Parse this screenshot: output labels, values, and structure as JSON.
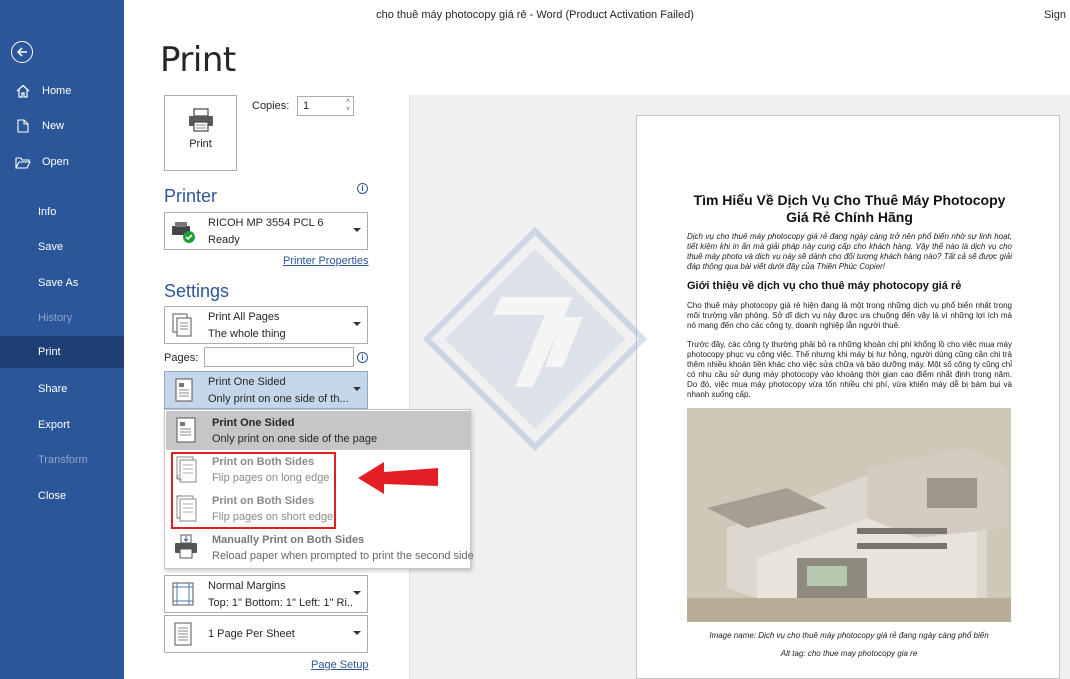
{
  "window": {
    "title": "cho thuê máy photocopy giá rẻ  -  Word (Product Activation Failed)",
    "sign_in": "Sign"
  },
  "sidebar": {
    "items": [
      {
        "label": "Home",
        "icon": "home-icon"
      },
      {
        "label": "New",
        "icon": "new-document-icon"
      },
      {
        "label": "Open",
        "icon": "folder-open-icon"
      },
      {
        "label": "Info"
      },
      {
        "label": "Save"
      },
      {
        "label": "Save As"
      },
      {
        "label": "History"
      },
      {
        "label": "Print"
      },
      {
        "label": "Share"
      },
      {
        "label": "Export"
      },
      {
        "label": "Transform"
      },
      {
        "label": "Close"
      }
    ]
  },
  "print": {
    "heading": "Print",
    "button_label": "Print",
    "copies_label": "Copies:",
    "copies_value": "1"
  },
  "printer": {
    "heading": "Printer",
    "name": "RICOH MP 3554 PCL 6",
    "status": "Ready",
    "properties_link": "Printer Properties"
  },
  "settings": {
    "heading": "Settings",
    "pages_range": {
      "line1": "Print All Pages",
      "line2": "The whole thing"
    },
    "pages_label": "Pages:",
    "pages_value": "",
    "sides": {
      "line1": "Print One Sided",
      "line2": "Only print on one side of th..."
    },
    "margins": {
      "line1": "Normal Margins",
      "line2": "Top: 1\" Bottom: 1\" Left: 1\" Ri..."
    },
    "per_sheet": {
      "line1": "1 Page Per Sheet"
    },
    "page_setup_link": "Page Setup"
  },
  "sides_menu": [
    {
      "title": "Print One Sided",
      "desc": "Only print on one side of the page"
    },
    {
      "title": "Print on Both Sides",
      "desc": "Flip pages on long edge"
    },
    {
      "title": "Print on Both Sides",
      "desc": "Flip pages on short edge"
    },
    {
      "title": "Manually Print on Both Sides",
      "desc": "Reload paper when prompted to print the second side"
    }
  ],
  "preview": {
    "title": "Tìm Hiểu Về Dịch Vụ Cho Thuê Máy Photocopy Giá Rẻ Chính Hãng",
    "intro": "Dịch vụ cho thuê máy photocopy giá rẻ đang ngày càng trở nên phổ biến nhờ sự linh hoạt, tiết kiệm khi in ấn mà giải pháp này cung cấp cho khách hàng. Vậy thế nào là dịch vụ cho thuê máy photo và dịch vụ này sẽ dành cho đối tượng khách hàng nào? Tất cả sẽ được giải đáp thông qua bài viết dưới đây của Thiên Phúc Copier!",
    "h2": "Giới thiệu về dịch vụ cho thuê máy photocopy giá rẻ",
    "p1": "Cho thuê máy photocopy giá rẻ hiện đang là một trong những dịch vụ phổ biến nhất trong môi trường văn phòng. Sở dĩ dịch vụ này được ưa chuộng đến vậy là vì những lợi ích mà nó mang đến cho các công ty, doanh nghiệp lẫn người thuê.",
    "p2": "Trước đây, các công ty thường phải bỏ ra những khoản chi phí khổng lồ cho việc mua máy photocopy phục vụ công việc. Thế nhưng khi máy bị hư hỏng, người dùng cũng cần chi trả thêm nhiều khoản tiền khác cho việc sửa chữa và bảo dưỡng máy. Một số công ty cũng chỉ có nhu cầu sử dụng máy photocopy vào khoảng thời gian cao điểm nhất định trong năm. Do đó, việc mua máy photocopy vừa tốn nhiều chi phí, vừa khiến máy dễ bị bám bụi và nhanh xuống cấp.",
    "caption1": "Image name: Dịch vụ cho thuê máy photocopy giá rẻ đang ngày càng phổ biến",
    "caption2": "Alt tag: cho thue may photocopy gia re"
  }
}
